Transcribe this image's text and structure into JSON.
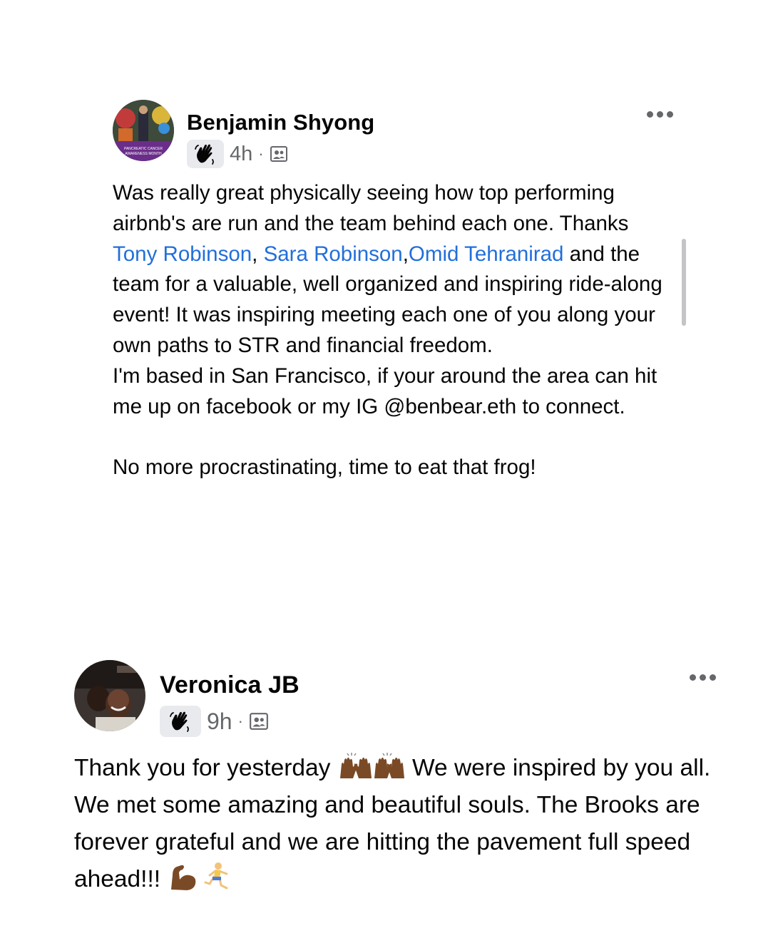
{
  "posts": [
    {
      "author": "Benjamin Shyong",
      "time": "4h",
      "separator": "·",
      "icons": {
        "badge": "wave-hand-icon",
        "audience": "group-icon",
        "menu": "more-options-icon"
      },
      "body": {
        "t1": "Was really great physically seeing how top performing airbnb's are run and the team behind each one. Thanks ",
        "mention1": "Tony Robinson",
        "t2": ", ",
        "mention2": "Sara Robinson",
        "t3": ",",
        "mention3": "Omid Tehranirad",
        "t4": " and the team for a valuable, well organized and inspiring ride-along event! It was inspiring meeting each one of you along your own paths to STR and financial freedom.",
        "t5": "I'm based in San Francisco, if your around the area can hit me up on facebook or my IG @benbear.eth to connect.",
        "t6": "No more procrastinating, time to eat that frog!"
      }
    },
    {
      "author": "Veronica JB",
      "time": "9h",
      "separator": "·",
      "icons": {
        "badge": "wave-hand-icon",
        "audience": "group-icon",
        "menu": "more-options-icon",
        "emoji1": "raising-hands-emoji",
        "emoji2": "flexed-biceps-emoji",
        "emoji3": "woman-running-emoji"
      },
      "body": {
        "t1": "Thank you for yesterday ",
        "t2": " We were inspired by you all. We met some amazing and beautiful souls. The Brooks are forever grateful and we are hitting the pavement full speed ahead!!! "
      }
    }
  ],
  "colors": {
    "link": "#216fdb",
    "meta": "#65676b",
    "text": "#050505"
  }
}
